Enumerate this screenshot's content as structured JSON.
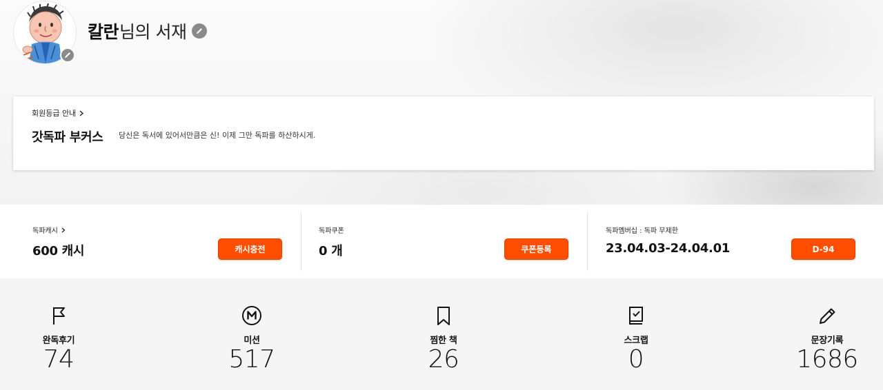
{
  "profile": {
    "name": "칼란",
    "title_suffix": "님의 서재",
    "avatar_icon": "avatar-drawing",
    "edit_icon": "pencil-icon"
  },
  "grade": {
    "link_label": "회원등급 안내",
    "name": "갓독파 부커스",
    "description": "당신은 독서에 있어서만큼은 신! 이제 그만 독파를 하산하시게."
  },
  "wallet": {
    "cash": {
      "label": "독파캐시",
      "value": "600 캐시",
      "button": "캐시충전"
    },
    "coupon": {
      "label": "독파쿠폰",
      "value": "0 개",
      "button": "쿠폰등록"
    },
    "membership": {
      "label": "독파멤버십 : 독파 무제한",
      "value": "23.04.03-24.04.01",
      "button": "D-94"
    },
    "accent_color": "#ff4e00"
  },
  "stats": [
    {
      "icon": "flag-icon",
      "label": "완독후기",
      "value": "74"
    },
    {
      "icon": "mission-m-icon",
      "label": "미션",
      "value": "517"
    },
    {
      "icon": "bookmark-icon",
      "label": "찜한 책",
      "value": "26"
    },
    {
      "icon": "scrap-book-icon",
      "label": "스크랩",
      "value": "0"
    },
    {
      "icon": "pencil-icon",
      "label": "문장기록",
      "value": "1686"
    }
  ]
}
